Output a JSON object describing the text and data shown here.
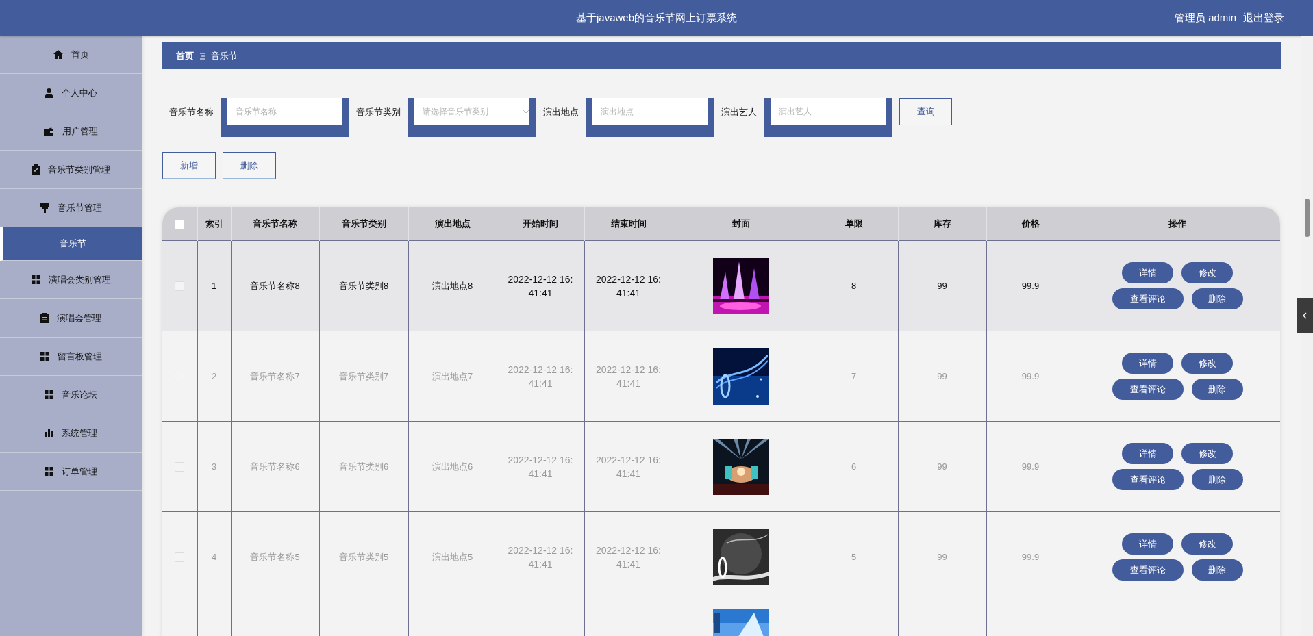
{
  "header": {
    "title": "基于javaweb的音乐节网上订票系统",
    "user": "管理员 admin",
    "logout": "退出登录"
  },
  "sidebar": {
    "items": [
      {
        "label": "首页",
        "selected": false
      },
      {
        "label": "个人中心",
        "selected": false
      },
      {
        "label": "用户管理",
        "selected": false
      },
      {
        "label": "音乐节类别管理",
        "selected": false
      },
      {
        "label": "音乐节管理",
        "selected": false,
        "expanded": true,
        "children": [
          {
            "label": "音乐节",
            "selected": true
          }
        ]
      },
      {
        "label": "演唱会类别管理",
        "selected": false
      },
      {
        "label": "演唱会管理",
        "selected": false
      },
      {
        "label": "留言板管理",
        "selected": false
      },
      {
        "label": "音乐论坛",
        "selected": false
      },
      {
        "label": "系统管理",
        "selected": false
      },
      {
        "label": "订单管理",
        "selected": false
      }
    ]
  },
  "breadcrumb": [
    "首页",
    "音乐节"
  ],
  "search": {
    "fields": [
      {
        "label": "音乐节名称",
        "placeholder": "音乐节名称",
        "kind": "text"
      },
      {
        "label": "音乐节类别",
        "placeholder": "请选择音乐节类别",
        "kind": "select"
      },
      {
        "label": "演出地点",
        "placeholder": "演出地点",
        "kind": "text"
      },
      {
        "label": "演出艺人",
        "placeholder": "演出艺人",
        "kind": "text"
      }
    ],
    "button": "查询"
  },
  "actions": [
    "新增",
    "删除"
  ],
  "table": {
    "select_all_checked": false,
    "columns": [
      "索引",
      "音乐节名称",
      "音乐节类别",
      "演出地点",
      "开始时间",
      "结束时间",
      "封面",
      "单限",
      "库存",
      "价格",
      "操作"
    ],
    "rows": [
      {
        "checked": false,
        "highlighted": true,
        "index": "1",
        "name": "音乐节名称8",
        "category": "音乐节类别8",
        "place": "演出地点8",
        "start": "2022-12-12 16:41:41",
        "end": "2022-12-12 16:41:41",
        "limit": "8",
        "stock": "99",
        "price": "99.9",
        "actions": [
          "详情",
          "修改",
          "查看评论",
          "删除"
        ]
      },
      {
        "checked": false,
        "highlighted": false,
        "index": "2",
        "name": "音乐节名称7",
        "category": "音乐节类别7",
        "place": "演出地点7",
        "start": "2022-12-12 16:41:41",
        "end": "2022-12-12 16:41:41",
        "limit": "7",
        "stock": "99",
        "price": "99.9",
        "actions": [
          "详情",
          "修改",
          "查看评论",
          "删除"
        ]
      },
      {
        "checked": false,
        "highlighted": false,
        "index": "3",
        "name": "音乐节名称6",
        "category": "音乐节类别6",
        "place": "演出地点6",
        "start": "2022-12-12 16:41:41",
        "end": "2022-12-12 16:41:41",
        "limit": "6",
        "stock": "99",
        "price": "99.9",
        "actions": [
          "详情",
          "修改",
          "查看评论",
          "删除"
        ]
      },
      {
        "checked": false,
        "highlighted": false,
        "index": "4",
        "name": "音乐节名称5",
        "category": "音乐节类别5",
        "place": "演出地点5",
        "start": "2022-12-12 16:41:41",
        "end": "2022-12-12 16:41:41",
        "limit": "5",
        "stock": "99",
        "price": "99.9",
        "actions": [
          "详情",
          "修改",
          "查看评论",
          "删除"
        ]
      }
    ]
  }
}
